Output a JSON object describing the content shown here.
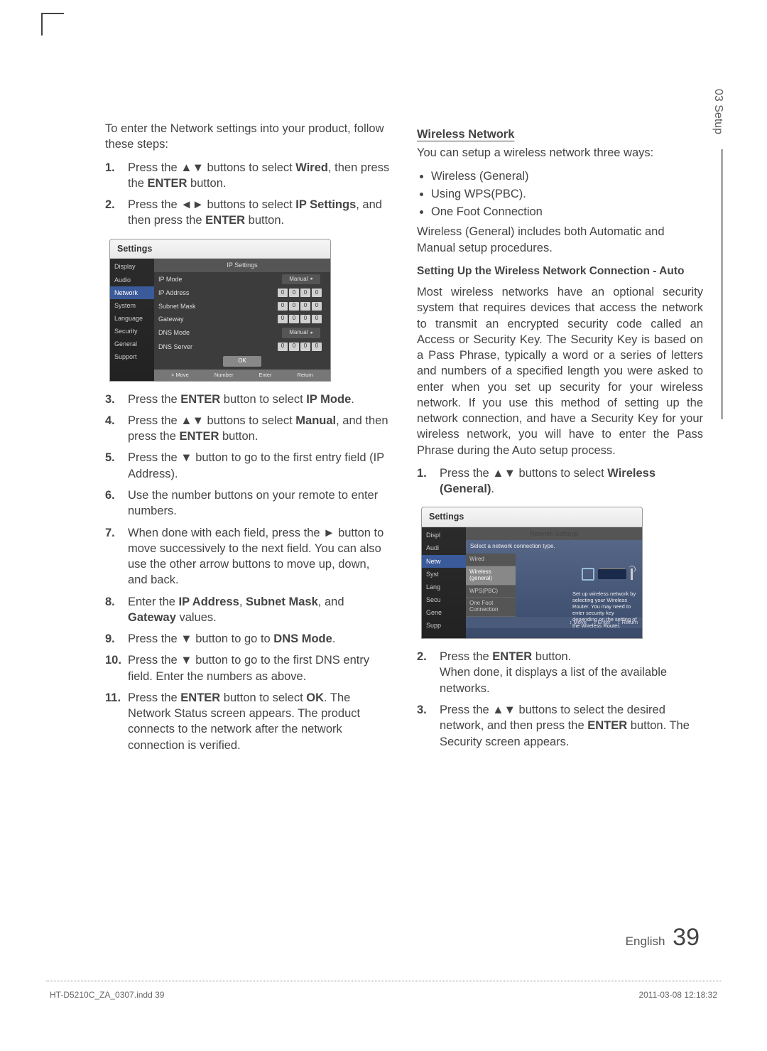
{
  "sideTab": "03  Setup",
  "left": {
    "intro": "To enter the Network settings into your product, follow these steps:",
    "steps_a": [
      {
        "n": "1.",
        "t1": "Press the ",
        "k1": "▲▼",
        "t2": " buttons to select ",
        "b": "Wired",
        "t3": ", then press the ",
        "b2": "ENTER",
        "t4": " button."
      },
      {
        "n": "2.",
        "t1": "Press the ",
        "k1": "◄►",
        "t2": " buttons to select ",
        "b": "IP Settings",
        "t3": ", and then press the ",
        "b2": "ENTER",
        "t4": " button."
      }
    ],
    "ui1": {
      "title": "Settings",
      "sidebar": [
        "Display",
        "Audio",
        "Network",
        "System",
        "Language",
        "Security",
        "General",
        "Support"
      ],
      "activeIndex": 2,
      "header": "IP Settings",
      "rows": [
        {
          "lbl": "IP Mode",
          "type": "val",
          "val": "Manual"
        },
        {
          "lbl": "IP Address",
          "type": "ip",
          "vals": [
            "0",
            "0",
            "0",
            "0"
          ]
        },
        {
          "lbl": "Subnet Mask",
          "type": "ip",
          "vals": [
            "0",
            "0",
            "0",
            "0"
          ]
        },
        {
          "lbl": "Gateway",
          "type": "ip",
          "vals": [
            "0",
            "0",
            "0",
            "0"
          ]
        },
        {
          "lbl": "DNS Mode",
          "type": "val",
          "val": "Manual"
        },
        {
          "lbl": "DNS Server",
          "type": "ip",
          "vals": [
            "0",
            "0",
            "0",
            "0"
          ]
        }
      ],
      "ok": "OK",
      "foot": [
        "> Move",
        "Number",
        "Enter",
        "Return"
      ]
    },
    "steps_b": [
      {
        "n": "3.",
        "html": "Press the <b>ENTER</b> button to select <b>IP Mode</b>."
      },
      {
        "n": "4.",
        "html": "Press the ▲▼ buttons to select <b>Manual</b>, and then press the <b>ENTER</b> button."
      },
      {
        "n": "5.",
        "html": "Press the ▼ button to go to the first entry field (IP Address)."
      },
      {
        "n": "6.",
        "html": "Use the number buttons on your remote to enter numbers."
      },
      {
        "n": "7.",
        "html": "When done with each field, press the ► button to move successively to the next field. You can also use the other arrow buttons to move up, down, and back."
      },
      {
        "n": "8.",
        "html": "Enter the <b>IP Address</b>, <b>Subnet Mask</b>, and <b>Gateway</b> values."
      },
      {
        "n": "9.",
        "html": "Press the ▼ button to go to <b>DNS Mode</b>."
      },
      {
        "n": "10.",
        "html": "Press the ▼ button to go to the first DNS entry field. Enter the numbers as above."
      },
      {
        "n": "11.",
        "html": "Press the <b>ENTER</b> button to select <b>OK</b>. The Network Status screen appears. The product connects to the network after the network connection is verified."
      }
    ]
  },
  "right": {
    "h1": "Wireless Network",
    "p1": "You can setup a wireless network three ways:",
    "bul": [
      "Wireless (General)",
      "Using WPS(PBC).",
      "One Foot Connection"
    ],
    "p2": "Wireless (General) includes both Automatic and Manual setup procedures.",
    "h2": "Setting Up the Wireless Network Connection - Auto",
    "p3": "Most wireless networks have an optional security system that requires devices that access the network to transmit an encrypted security code called an Access or Security Key. The Security Key is based on a Pass Phrase, typically a word or a series of letters and numbers of a specified length you were asked to enter when you set up security for your wireless network. If you use this method of setting up the network connection, and have a Security Key for your wireless network, you will have to enter the Pass Phrase during the Auto setup process.",
    "steps_c": [
      {
        "n": "1.",
        "html": "Press the ▲▼ buttons to select <b>Wireless (General)</b>."
      }
    ],
    "ui2": {
      "title": "Settings",
      "sidebar": [
        "Displ",
        "Audi",
        "Netw",
        "Syst",
        "Lang",
        "Secu",
        "Gene",
        "Supp"
      ],
      "header": "Network Settings",
      "subhead": "Select a network connection type.",
      "list": [
        "Wired",
        "Wireless (general)",
        "WPS(PBC)",
        "One Foot Connection"
      ],
      "listSel": 1,
      "desc": "Set up wireless network by selecting your Wireless Router. You may need to enter security key depending on the setting of the Wireless Router.",
      "foot": [
        "Move",
        "Enter",
        "Return"
      ]
    },
    "steps_d": [
      {
        "n": "2.",
        "html": "Press the <b>ENTER</b> button.<br>When done, it displays a list of the available networks."
      },
      {
        "n": "3.",
        "html": "Press the ▲▼ buttons to select the desired network, and then press the <b>ENTER</b> button. The Security screen appears."
      }
    ]
  },
  "footer": {
    "lang": "English",
    "page": "39"
  },
  "meta": {
    "file": "HT-D5210C_ZA_0307.indd   39",
    "date": "2011-03-08   12:18:32"
  }
}
